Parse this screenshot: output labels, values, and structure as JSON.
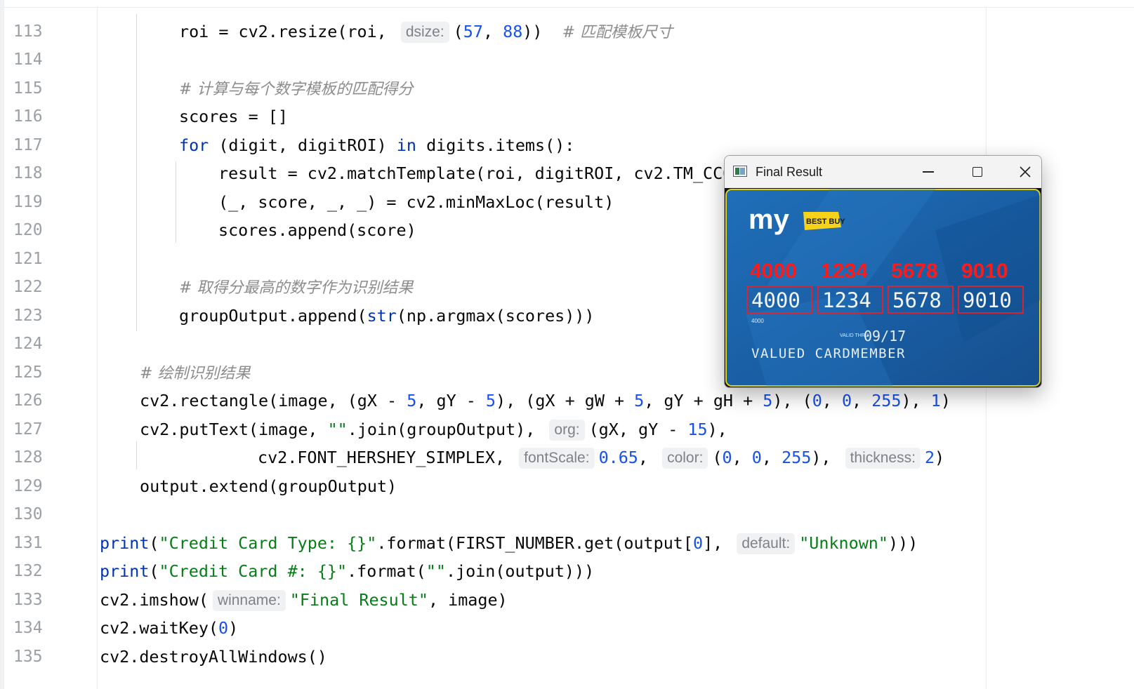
{
  "editor": {
    "line_numbers": [
      "113",
      "114",
      "115",
      "116",
      "117",
      "118",
      "119",
      "120",
      "121",
      "122",
      "123",
      "124",
      "125",
      "126",
      "127",
      "128",
      "129",
      "130",
      "131",
      "132",
      "133",
      "134",
      "135"
    ],
    "code": {
      "l113": [
        "roi = cv2.resize(roi, ",
        "dsize:",
        "(",
        "57",
        ", ",
        "88",
        "))",
        "# 匹配模板尺寸"
      ],
      "l115": "# 计算与每个数字模板的匹配得分",
      "l116": "scores = []",
      "l117": [
        "for",
        " (digit, digitROI) ",
        "in",
        " digits.items():"
      ],
      "l118": "result = cv2.matchTemplate(roi, digitROI, cv2.TM_CCOEFF)",
      "l119": "(_, score, _, _) = cv2.minMaxLoc(result)",
      "l120": "scores.append(score)",
      "l122": "# 取得分最高的数字作为识别结果",
      "l123": [
        "groupOutput.append(",
        "str",
        "(np.argmax(scores)))"
      ],
      "l125": "# 绘制识别结果",
      "l126": [
        "cv2.rectangle(image, (gX - ",
        "5",
        ", gY - ",
        "5",
        "), (gX + gW + ",
        "5",
        ", gY + gH + ",
        "5",
        "), (",
        "0",
        ", ",
        "0",
        ", ",
        "255",
        "), ",
        "1",
        ")"
      ],
      "l127": [
        "cv2.putText(image, ",
        "\"\"",
        ".join(groupOutput), ",
        "org:",
        "(gX, gY - ",
        "15",
        "),"
      ],
      "l128": [
        "cv2.FONT_HERSHEY_SIMPLEX, ",
        "fontScale:",
        "0.65",
        ", ",
        "color:",
        "(",
        "0",
        ", ",
        "0",
        ", ",
        "255",
        "), ",
        "thickness:",
        "2",
        ")"
      ],
      "l129": "output.extend(groupOutput)",
      "l131": [
        "print",
        "(",
        "\"Credit Card Type: {}\"",
        ".format(FIRST_NUMBER.get(output[",
        "0",
        "], ",
        "default:",
        "\"Unknown\"",
        ")))"
      ],
      "l132": [
        "print",
        "(",
        "\"Credit Card #: {}\"",
        ".format(",
        "\"\"",
        ".join(output)))"
      ],
      "l133": [
        "cv2.imshow(",
        "winname:",
        "\"Final Result\"",
        ", image)"
      ],
      "l134": [
        "cv2.waitKey(",
        "0",
        ")"
      ],
      "l135": "cv2.destroyAllWindows()"
    }
  },
  "window": {
    "title": "Final Result",
    "minimize_icon": "minimize-icon",
    "maximize_icon": "maximize-icon",
    "close_icon": "close-icon"
  },
  "card": {
    "brand_my": "my",
    "brand_logo": "BEST BUY",
    "detected_groups": [
      "4000",
      "1234",
      "5678",
      "9010"
    ],
    "card_groups": [
      "4000",
      "1234",
      "5678",
      "9010"
    ],
    "small_number": "4000",
    "valid_thru": "VALID THRU",
    "expiry": "09/17",
    "cardholder": "VALUED CARDMEMBER",
    "colors": {
      "card_blue": "#1a5fa6",
      "detection_red": "#ff1a1a",
      "border_yellow": "#d8d21a",
      "logo_yellow": "#f6d31a"
    }
  }
}
